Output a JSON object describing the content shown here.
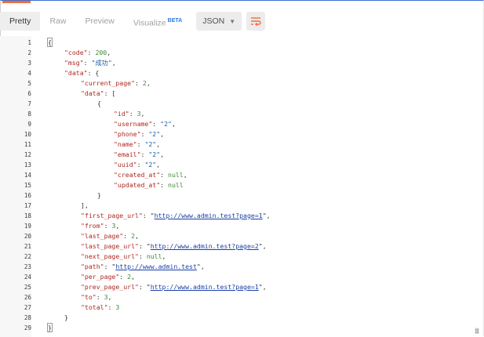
{
  "tabs": [
    {
      "label": "Pretty"
    },
    {
      "label": "Raw"
    },
    {
      "label": "Preview"
    },
    {
      "label": "Visualize",
      "badge": "BETA"
    }
  ],
  "format": {
    "value": "JSON"
  },
  "colors": {
    "accent": "#f26b3a",
    "wrap_icon": "#f26b3a",
    "key": "#b0271f",
    "string": "#1a5fa8",
    "number": "#3f8a3a"
  },
  "icons": {
    "wrap": "wrap-lines-icon",
    "dropdown": "chevron-down-icon",
    "corner": "resize-icon"
  },
  "line_numbers": [
    "1",
    "2",
    "3",
    "4",
    "5",
    "6",
    "7",
    "8",
    "9",
    "10",
    "11",
    "12",
    "13",
    "14",
    "15",
    "16",
    "17",
    "18",
    "19",
    "20",
    "21",
    "22",
    "23",
    "24",
    "25",
    "26",
    "27",
    "28",
    "29"
  ],
  "body": {
    "code": "200",
    "msg": "\"成功\"",
    "current_page": "2",
    "id": "3",
    "username": "\"2\"",
    "phone": "\"2\"",
    "name": "\"2\"",
    "email": "\"2\"",
    "uuid": "\"2\"",
    "created_at": "null",
    "updated_at": "null",
    "first_page_url": "http://www.admin.test?page=1",
    "from": "3",
    "last_page": "2",
    "last_page_url": "http://www.admin.test?page=2",
    "next_page_url": "null",
    "path": "http://www.admin.test",
    "per_page": "2",
    "prev_page_url": "http://www.admin.test?page=1",
    "to": "3",
    "total": "3"
  }
}
